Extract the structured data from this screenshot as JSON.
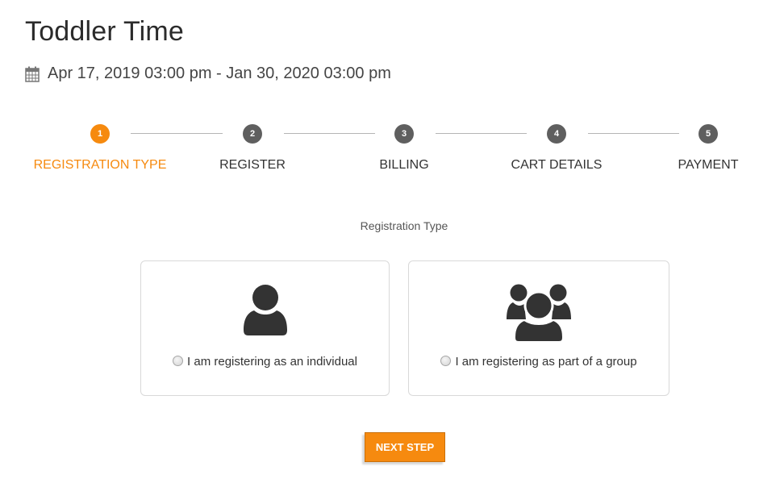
{
  "event": {
    "title": "Toddler Time",
    "date_icon": "calendar-icon",
    "date_range": "Apr 17, 2019 03:00 pm - Jan 30, 2020 03:00 pm"
  },
  "wizard": {
    "active_step": 1,
    "steps": [
      {
        "number": "1",
        "label": "REGISTRATION TYPE",
        "state": "active"
      },
      {
        "number": "2",
        "label": "REGISTER",
        "state": "pending"
      },
      {
        "number": "3",
        "label": "BILLING",
        "state": "pending"
      },
      {
        "number": "4",
        "label": "CART DETAILS",
        "state": "pending"
      },
      {
        "number": "5",
        "label": "PAYMENT",
        "state": "pending"
      }
    ]
  },
  "registration": {
    "section_label": "Registration Type",
    "options": [
      {
        "icon": "user-icon",
        "label": "I am registering as an individual",
        "selected": false
      },
      {
        "icon": "users-group-icon",
        "label": "I am registering as part of a group",
        "selected": false
      }
    ]
  },
  "actions": {
    "next_label": "NEXT STEP"
  },
  "colors": {
    "accent": "#f68a0f",
    "step_inactive": "#5f5f5f",
    "text": "#333333"
  }
}
